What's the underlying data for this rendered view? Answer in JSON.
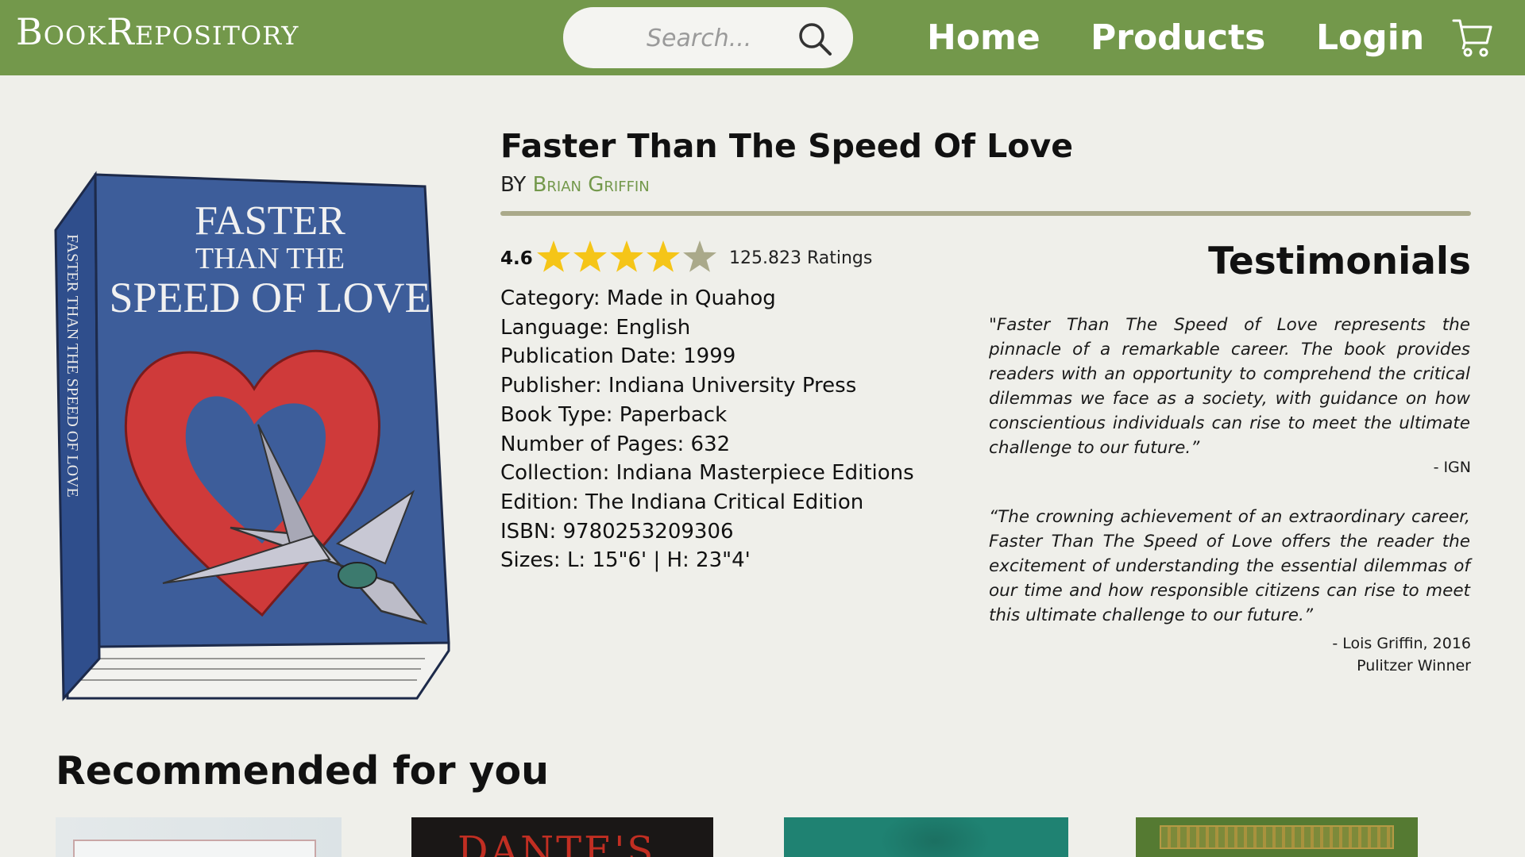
{
  "header": {
    "logo": "BookRepository",
    "search_placeholder": "Search...",
    "nav": [
      "Home",
      "Products",
      "Login"
    ],
    "cart_icon": "cart-icon",
    "colors": {
      "bar": "#73984b",
      "text": "#ffffff"
    }
  },
  "book": {
    "cover_title_line1": "FASTER",
    "cover_title_line2": "THAN THE",
    "cover_title_line3": "SPEED OF LOVE",
    "spine_text": "FASTER THAN THE SPEED OF LOVE",
    "title": "Faster Than The Speed Of Love",
    "by_label": "BY",
    "author": "Brian Griffin",
    "rating": "4.6",
    "rating_stars": 4.6,
    "rating_max": 5,
    "ratings_count": "125.823 Ratings",
    "details": [
      "Category: Made in Quahog",
      "Language: English",
      "Publication Date: 1999",
      "Publisher: Indiana University Press",
      "Book Type: Paperback",
      "Number of Pages: 632",
      "Collection: Indiana Masterpiece Editions",
      "Edition: The Indiana Critical Edition",
      "ISBN: 9780253209306",
      "Sizes: L: 15\"6' | H: 23\"4'"
    ]
  },
  "testimonials": {
    "heading": "Testimonials",
    "items": [
      {
        "quote": "\"Faster Than The Speed of Love represents the pinnacle of a remarkable career. The book provides readers with an opportunity to comprehend the critical dilemmas we face as a society, with guidance on how conscientious individuals can rise to meet the ultimate challenge to our future.”",
        "author_line1": "- IGN",
        "author_line2": ""
      },
      {
        "quote": "“The crowning achievement of an extraordinary career, Faster Than The Speed of Love offers the reader the excitement of understanding the essential dilemmas of our time and how responsible citizens can rise to meet this ultimate challenge to our future.”",
        "author_line1": "- Lois Griffin, 2016",
        "author_line2": "Pulitzer Winner"
      }
    ]
  },
  "recommended": {
    "heading": "Recommended for you",
    "items": [
      {
        "visible_text": ""
      },
      {
        "visible_text": "DANTE'S"
      },
      {
        "visible_text": ""
      },
      {
        "visible_text": ""
      }
    ]
  },
  "colors": {
    "accent": "#73984b",
    "star_filled": "#f5c518",
    "star_empty": "#aaa98a",
    "cover_blue": "#3d5d9a",
    "divider": "#aaa98a"
  }
}
